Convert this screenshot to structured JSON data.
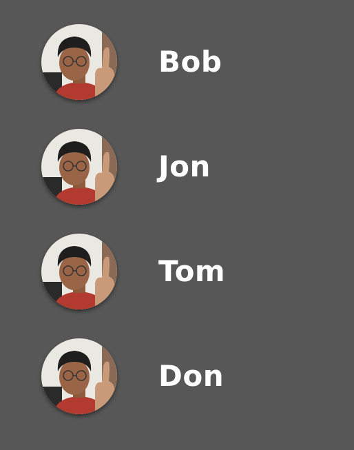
{
  "theme": {
    "background": "#575757",
    "text": "#ffffff"
  },
  "contacts": [
    {
      "name": "Bob",
      "avatar_icon": "profile-photo"
    },
    {
      "name": "Jon",
      "avatar_icon": "profile-photo"
    },
    {
      "name": "Tom",
      "avatar_icon": "profile-photo"
    },
    {
      "name": "Don",
      "avatar_icon": "profile-photo"
    }
  ]
}
